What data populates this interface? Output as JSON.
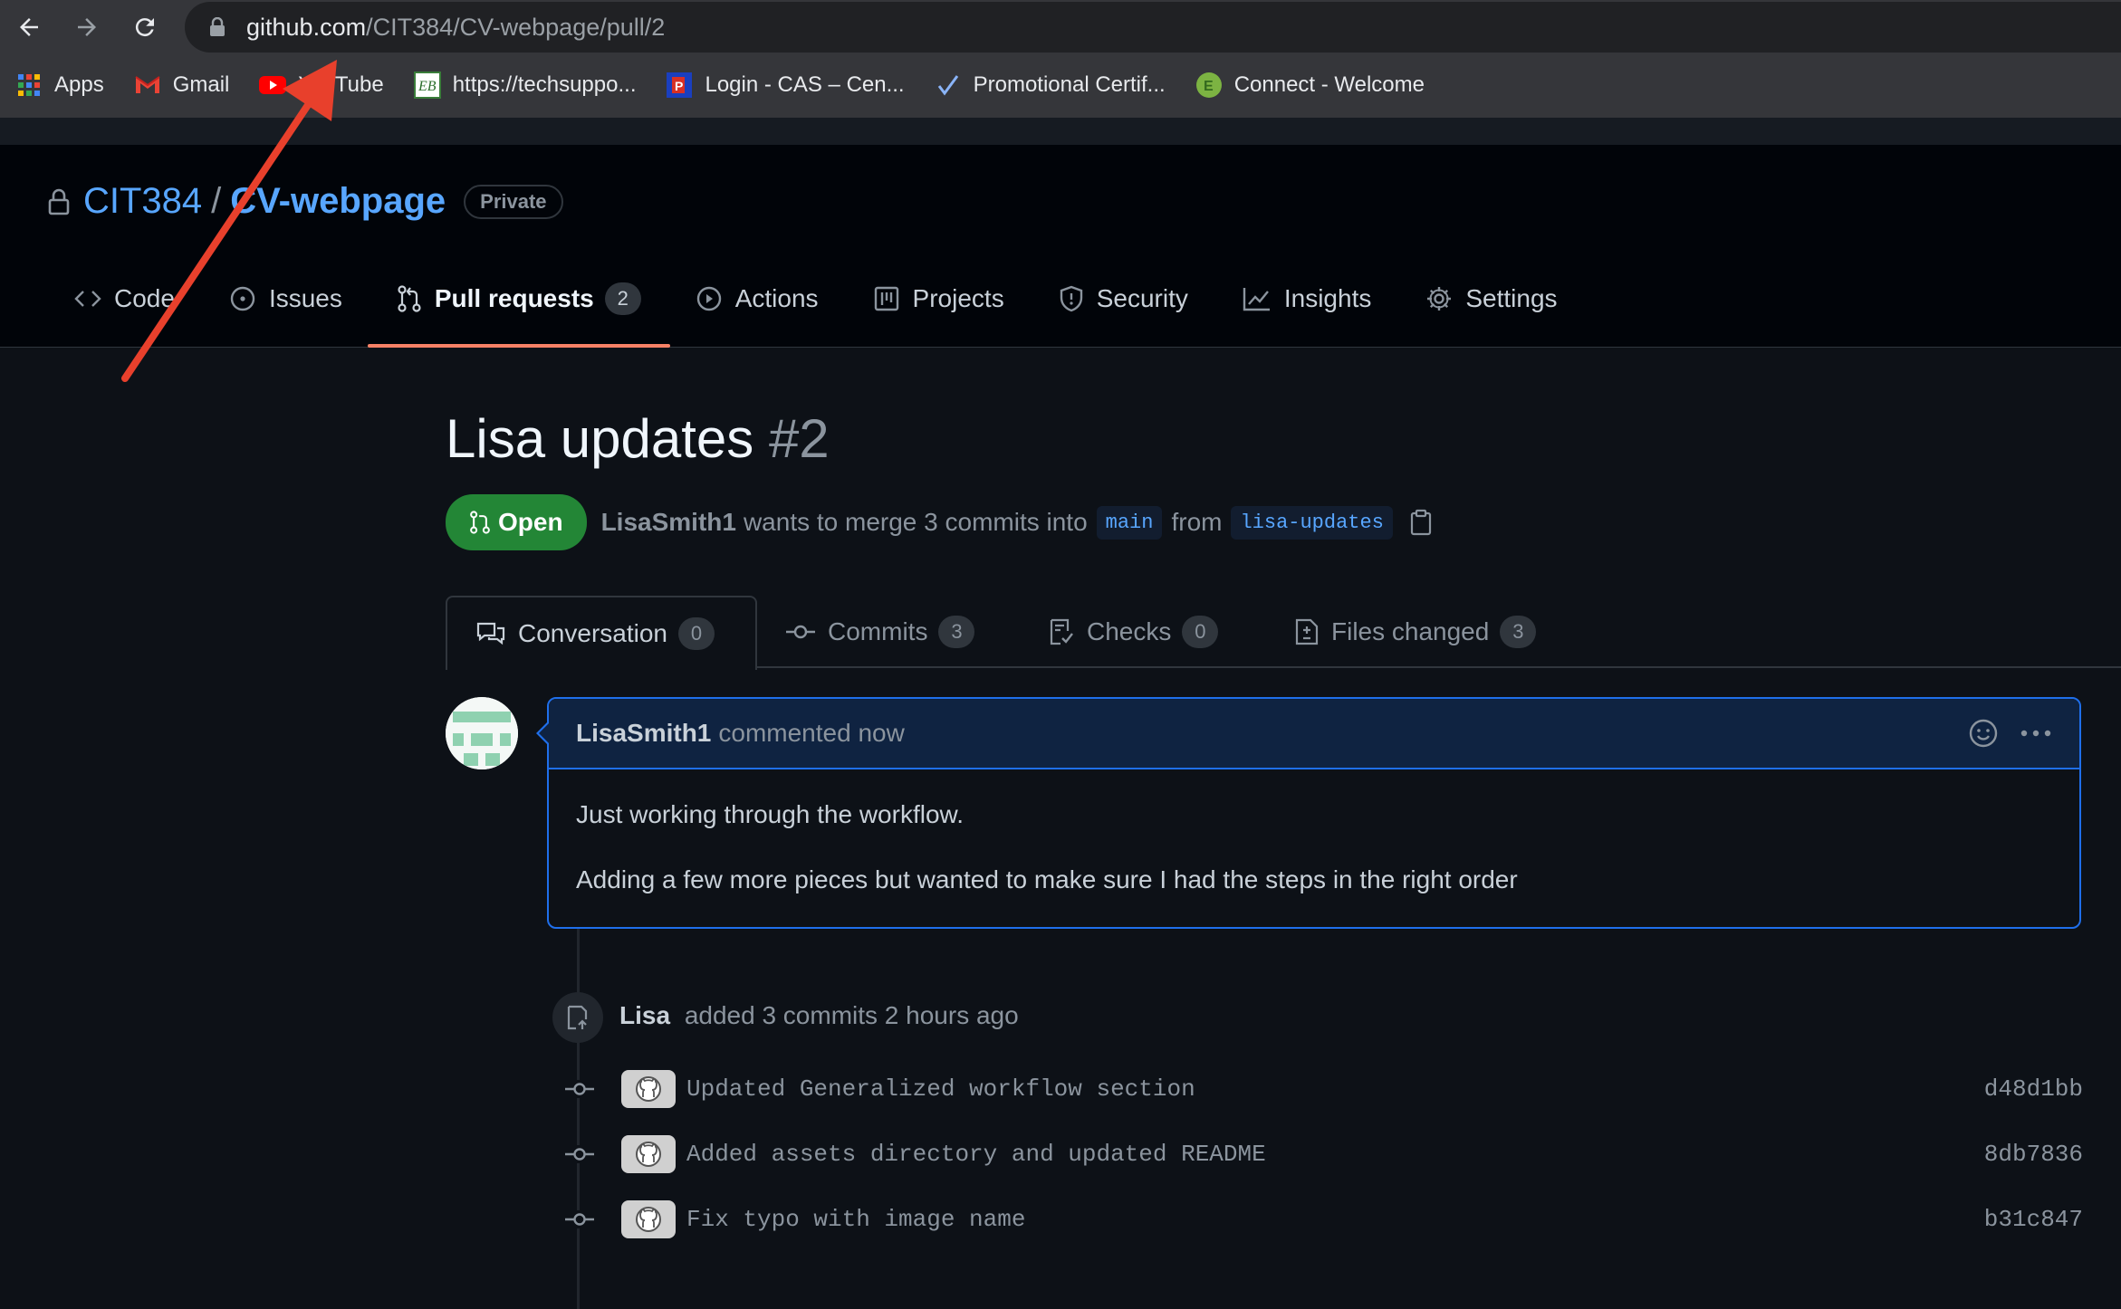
{
  "browser": {
    "url_host": "github.com",
    "url_path": "/CIT384/CV-webpage/pull/2",
    "bookmarks": [
      {
        "label": "Apps",
        "icon": "apps-grid-icon"
      },
      {
        "label": "Gmail",
        "icon": "gmail-icon"
      },
      {
        "label": "YouTube",
        "icon": "youtube-icon"
      },
      {
        "label": "https://techsuppo...",
        "icon": "eb-icon"
      },
      {
        "label": "Login - CAS – Cen...",
        "icon": "cas-icon"
      },
      {
        "label": "Promotional Certif...",
        "icon": "checkmark-icon"
      },
      {
        "label": "Connect - Welcome",
        "icon": "e-circle-icon"
      }
    ]
  },
  "repo": {
    "owner": "CIT384",
    "separator": "/",
    "name": "CV-webpage",
    "visibility": "Private",
    "tabs": [
      {
        "label": "Code",
        "icon": "code-icon"
      },
      {
        "label": "Issues",
        "icon": "issue-icon"
      },
      {
        "label": "Pull requests",
        "icon": "pull-request-icon",
        "count": "2",
        "active": true
      },
      {
        "label": "Actions",
        "icon": "play-icon"
      },
      {
        "label": "Projects",
        "icon": "project-icon"
      },
      {
        "label": "Security",
        "icon": "shield-icon"
      },
      {
        "label": "Insights",
        "icon": "graph-icon"
      },
      {
        "label": "Settings",
        "icon": "gear-icon"
      }
    ]
  },
  "pr": {
    "title": "Lisa updates",
    "number": "#2",
    "state": "Open",
    "author": "LisaSmith1",
    "merge_text_1": "wants to merge 3 commits into",
    "base_branch": "main",
    "merge_text_2": "from",
    "head_branch": "lisa-updates",
    "tabs": [
      {
        "label": "Conversation",
        "count": "0",
        "icon": "comment-discussion-icon"
      },
      {
        "label": "Commits",
        "count": "3",
        "icon": "git-commit-icon"
      },
      {
        "label": "Checks",
        "count": "0",
        "icon": "checklist-icon"
      },
      {
        "label": "Files changed",
        "count": "3",
        "icon": "file-diff-icon"
      }
    ]
  },
  "comment": {
    "author": "LisaSmith1",
    "time": "commented now",
    "body": [
      "Just working through the workflow.",
      "Adding a few more pieces but wanted to make sure I had the steps in the right order"
    ]
  },
  "timeline": {
    "push_author": "Lisa",
    "push_text": "added 3 commits 2 hours ago",
    "commits": [
      {
        "message": "Updated Generalized workflow section",
        "sha": "d48d1bb"
      },
      {
        "message": "Added assets directory and updated README",
        "sha": "8db7836"
      },
      {
        "message": "Fix typo with image name",
        "sha": "b31c847"
      }
    ]
  },
  "colors": {
    "bg": "#0d1117",
    "link": "#58a6ff",
    "open_green": "#238636",
    "tab_underline": "#f78166",
    "comment_border": "#1f6feb",
    "annotation_arrow": "#e8402c"
  }
}
